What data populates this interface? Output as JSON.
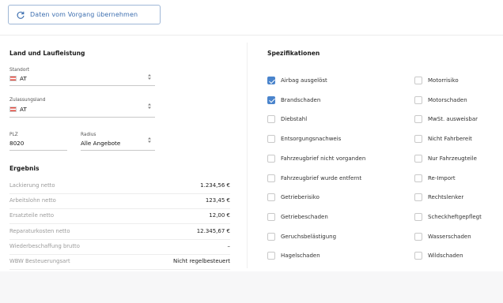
{
  "toolbar": {
    "sync_label": "Daten vom Vorgang übernehmen",
    "sync_icon": "refresh-icon"
  },
  "left": {
    "title": "Land und Laufleistung",
    "location": {
      "label": "Standort",
      "value": "AT"
    },
    "registration": {
      "label": "Zulassungsland",
      "value": "AT"
    },
    "zip": {
      "label": "PLZ",
      "value": "8020"
    },
    "radius": {
      "label": "Radius",
      "value": "Alle Angebote"
    }
  },
  "result": {
    "title": "Ergebnis",
    "rows": [
      {
        "label": "Lackierung netto",
        "value": "1.234,56 €"
      },
      {
        "label": "Arbeitslohn netto",
        "value": "123,45 €"
      },
      {
        "label": "Ersatzteile netto",
        "value": "12,00 €"
      },
      {
        "label": "Reparaturkosten netto",
        "value": "12.345,67 €"
      },
      {
        "label": "Wiederbeschaffung brutto",
        "value": "–"
      },
      {
        "label": "WBW Besteuerungsart",
        "value": "Nicht regelbesteuert"
      }
    ]
  },
  "specs": {
    "title": "Spezifikationen",
    "col1": [
      {
        "label": "Airbag ausgelöst",
        "checked": true
      },
      {
        "label": "Brandschaden",
        "checked": true
      },
      {
        "label": "Diebstahl",
        "checked": false
      },
      {
        "label": "Entsorgungsnachweis",
        "checked": false
      },
      {
        "label": "Fahrzeugbrief nicht vorganden",
        "checked": false
      },
      {
        "label": "Fahrzeugbrief wurde entfernt",
        "checked": false
      },
      {
        "label": "Getrieberisiko",
        "checked": false
      },
      {
        "label": "Getriebeschaden",
        "checked": false
      },
      {
        "label": "Geruchsbelästigung",
        "checked": false
      },
      {
        "label": "Hagelschaden",
        "checked": false
      }
    ],
    "col2": [
      {
        "label": "Motorrisiko",
        "checked": false
      },
      {
        "label": "Motorschaden",
        "checked": false
      },
      {
        "label": "MwSt. ausweisbar",
        "checked": false
      },
      {
        "label": "Nicht Fahrbereit",
        "checked": false
      },
      {
        "label": "Nur Fahrzeugteile",
        "checked": false
      },
      {
        "label": "Re-Import",
        "checked": false
      },
      {
        "label": "Rechtslenker",
        "checked": false
      },
      {
        "label": "Scheckheftgepflegt",
        "checked": false
      },
      {
        "label": "Wasserschaden",
        "checked": false
      },
      {
        "label": "Wildschaden",
        "checked": false
      }
    ]
  },
  "colors": {
    "accent": "#4a84cc",
    "button_text": "#3d6fb0"
  }
}
